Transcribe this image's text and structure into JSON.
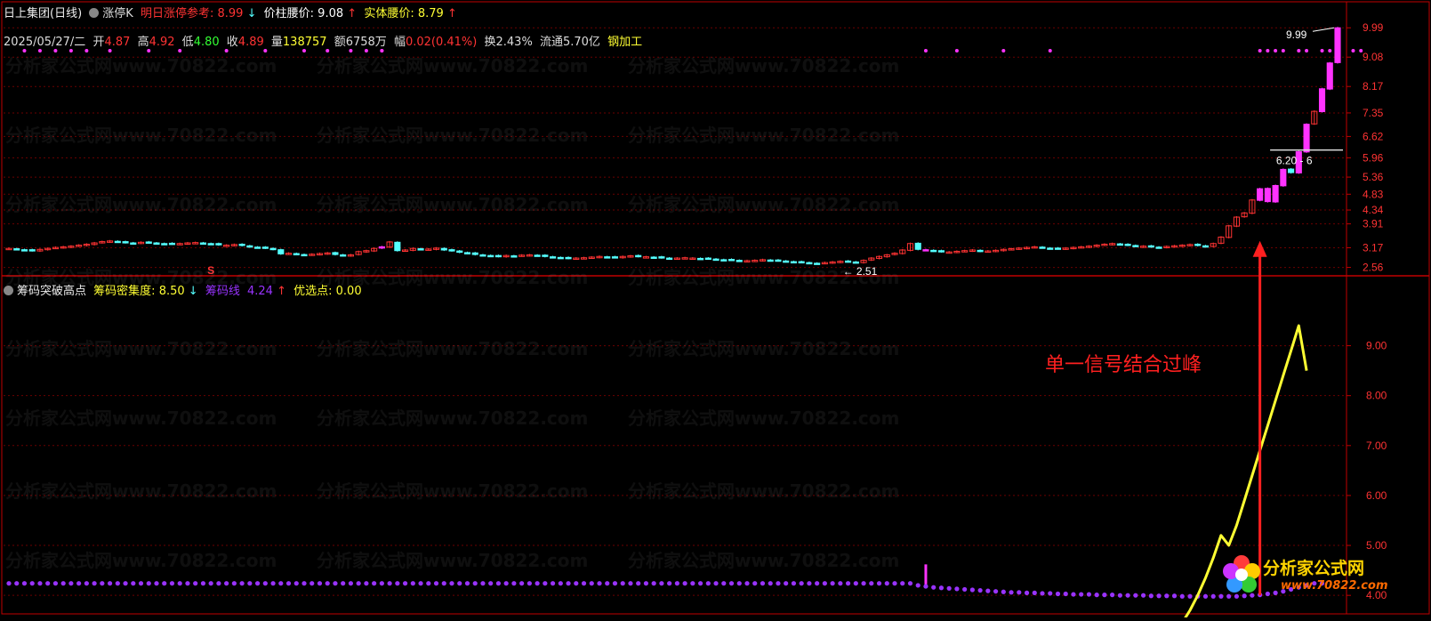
{
  "colors": {
    "up": "#ff3333",
    "down": "#54ffff",
    "limit_up": "#ff33ff",
    "border": "#c00000",
    "grid": "#6b0000",
    "yellow": "#ffff33",
    "purple": "#9933ff",
    "white": "#ffffff"
  },
  "header": {
    "stock_name": "日上集团(日线)",
    "indicator": "涨停K",
    "next_limit_label": "明日涨停参考:",
    "next_limit_value": "8.99",
    "next_limit_arrow": "↓",
    "bar_waist_label": "价柱腰价:",
    "bar_waist_value": "9.08",
    "bar_waist_arrow": "↑",
    "body_waist_label": "实体腰价:",
    "body_waist_value": "8.79",
    "body_waist_arrow": "↑"
  },
  "quote": {
    "date": "2025/05/27/二",
    "open_label": "开",
    "open": "4.87",
    "high_label": "高",
    "high": "4.92",
    "low_label": "低",
    "low": "4.80",
    "close_label": "收",
    "close": "4.89",
    "volume_label": "量",
    "volume": "138757",
    "amount_label": "额",
    "amount": "6758万",
    "change_label": "幅",
    "change": "0.02(0.41%)",
    "turnover_label": "换",
    "turnover": "2.43%",
    "float_label": "流通",
    "float_value": "5.70亿",
    "industry": "钢加工"
  },
  "lower_header": {
    "title": "筹码突破高点",
    "density_label": "筹码密集度:",
    "density_value": "8.50",
    "density_arrow": "↓",
    "chip_line_label": "筹码线",
    "chip_line_value": "4.24",
    "chip_line_arrow": "↑",
    "pick_label": "优选点:",
    "pick_value": "0.00"
  },
  "annotations": {
    "signal_text": "单一信号结合过峰",
    "max_label": "9.99",
    "low_label": "2.51",
    "range_label": "6.20 - 6",
    "s_marker": "S"
  },
  "watermark": {
    "text": "分析家公式网www.70822.com"
  },
  "logo": {
    "name": "分析家公式网",
    "url": "www.70822.com"
  },
  "chart_data": [
    {
      "type": "candlestick",
      "ylim": [
        2.3,
        10.3
      ],
      "y_ticks": [
        "9.99",
        "9.08",
        "8.17",
        "7.35",
        "6.62",
        "5.96",
        "5.36",
        "4.83",
        "4.34",
        "3.91",
        "3.17",
        "2.56"
      ],
      "y_tick_values": [
        9.99,
        9.08,
        8.17,
        7.35,
        6.62,
        5.96,
        5.36,
        4.83,
        4.34,
        3.91,
        3.17,
        2.56
      ],
      "closes": [
        3.15,
        3.12,
        3.1,
        3.08,
        3.12,
        3.15,
        3.18,
        3.2,
        3.22,
        3.25,
        3.28,
        3.32,
        3.36,
        3.38,
        3.35,
        3.33,
        3.32,
        3.34,
        3.33,
        3.31,
        3.3,
        3.29,
        3.3,
        3.32,
        3.33,
        3.31,
        3.29,
        3.26,
        3.25,
        3.27,
        3.24,
        3.2,
        3.18,
        3.16,
        3.12,
        2.98,
        3.0,
        2.97,
        2.95,
        2.97,
        2.99,
        3.01,
        2.96,
        2.93,
        2.95,
        3.05,
        3.08,
        3.15,
        3.2,
        3.35,
        3.08,
        3.1,
        3.15,
        3.12,
        3.13,
        3.16,
        3.1,
        3.08,
        3.03,
        3.0,
        2.96,
        2.94,
        2.92,
        2.9,
        2.93,
        2.92,
        2.94,
        2.95,
        2.93,
        2.9,
        2.88,
        2.86,
        2.84,
        2.85,
        2.86,
        2.88,
        2.9,
        2.88,
        2.87,
        2.9,
        2.92,
        2.9,
        2.89,
        2.88,
        2.86,
        2.84,
        2.85,
        2.86,
        2.85,
        2.84,
        2.83,
        2.81,
        2.8,
        2.79,
        2.78,
        2.77,
        2.78,
        2.8,
        2.78,
        2.77,
        2.75,
        2.73,
        2.72,
        2.7,
        2.69,
        2.71,
        2.73,
        2.75,
        2.74,
        2.72,
        2.78,
        2.85,
        2.9,
        2.95,
        3.0,
        3.1,
        3.3,
        3.12,
        3.1,
        3.07,
        3.05,
        3.04,
        3.06,
        3.08,
        3.1,
        3.06,
        3.07,
        3.09,
        3.12,
        3.14,
        3.16,
        3.18,
        3.2,
        3.17,
        3.15,
        3.14,
        3.16,
        3.18,
        3.2,
        3.22,
        3.25,
        3.28,
        3.3,
        3.27,
        3.25,
        3.23,
        3.22,
        3.2,
        3.19,
        3.21,
        3.23,
        3.25,
        3.27,
        3.24,
        3.22,
        3.3,
        3.5,
        3.85,
        4.12,
        4.25,
        4.65,
        5.0,
        4.6,
        5.1,
        5.6,
        5.5,
        6.15,
        7.0,
        7.4,
        8.1,
        8.9,
        9.99
      ],
      "limit_up_days": [
        48,
        118,
        161,
        162,
        163,
        164,
        166,
        167,
        169,
        170,
        171,
        173,
        174
      ],
      "signal_day": 161
    },
    {
      "type": "line",
      "ylim": [
        3.7,
        10.4
      ],
      "y_ticks": [
        "9.00",
        "8.00",
        "7.00",
        "6.00",
        "5.00",
        "4.00"
      ],
      "y_tick_values": [
        9.0,
        8.0,
        7.0,
        6.0,
        5.0,
        4.0
      ],
      "series": [
        {
          "name": "筹码线",
          "values": [
            4.24,
            4.24,
            4.24,
            4.24,
            4.24,
            4.24,
            4.24,
            4.24,
            4.24,
            4.24,
            4.24,
            4.24,
            4.24,
            4.24,
            4.24,
            4.24,
            4.24,
            4.24,
            4.24,
            4.24,
            4.24,
            4.24,
            4.24,
            4.24,
            4.24,
            4.24,
            4.24,
            4.24,
            4.24,
            4.24,
            4.24,
            4.24,
            4.24,
            4.24,
            4.24,
            4.24,
            4.24,
            4.24,
            4.24,
            4.24,
            4.24,
            4.24,
            4.24,
            4.24,
            4.24,
            4.24,
            4.24,
            4.24,
            4.24,
            4.24,
            4.24,
            4.24,
            4.24,
            4.24,
            4.24,
            4.24,
            4.24,
            4.24,
            4.24,
            4.24,
            4.24,
            4.24,
            4.24,
            4.24,
            4.24,
            4.24,
            4.24,
            4.24,
            4.24,
            4.24,
            4.24,
            4.24,
            4.24,
            4.24,
            4.24,
            4.24,
            4.24,
            4.24,
            4.24,
            4.24,
            4.24,
            4.24,
            4.24,
            4.24,
            4.24,
            4.24,
            4.24,
            4.24,
            4.24,
            4.24,
            4.24,
            4.24,
            4.24,
            4.24,
            4.24,
            4.24,
            4.24,
            4.24,
            4.24,
            4.24,
            4.24,
            4.24,
            4.24,
            4.24,
            4.24,
            4.24,
            4.24,
            4.24,
            4.24,
            4.24,
            4.24,
            4.24,
            4.24,
            4.24,
            4.24,
            4.24,
            4.24,
            4.2,
            4.18,
            4.16,
            4.15,
            4.14,
            4.13,
            4.12,
            4.11,
            4.1,
            4.09,
            4.08,
            4.07,
            4.06,
            4.06,
            4.05,
            4.05,
            4.04,
            4.04,
            4.03,
            4.03,
            4.02,
            4.02,
            4.02,
            4.01,
            4.01,
            4.01,
            4.0,
            4.0,
            4.0,
            4.0,
            3.99,
            3.99,
            3.99,
            3.99,
            3.98,
            3.98,
            3.98,
            3.98,
            3.98,
            3.98,
            3.98,
            3.98,
            3.99,
            4.0,
            4.01,
            4.03,
            4.05,
            4.08,
            4.12,
            4.16,
            4.2,
            4.24,
            4.24
          ]
        },
        {
          "name": "筹码密集度",
          "values": [
            3.3,
            3.28,
            3.27,
            3.28,
            3.3,
            3.35,
            3.38,
            3.4,
            3.42,
            3.44,
            3.45,
            3.43,
            3.41,
            3.4,
            3.42,
            3.41,
            3.39,
            3.38,
            3.4,
            3.41,
            3.42,
            3.41,
            3.4,
            3.38,
            3.36,
            3.35,
            3.34,
            3.33,
            3.34,
            3.33,
            3.3,
            3.22,
            3.15,
            3.08,
            3.05,
            3.07,
            3.1,
            3.08,
            3.06,
            3.07,
            3.1,
            3.12,
            3.2,
            3.35,
            3.44,
            3.3,
            3.22,
            3.2,
            3.24,
            3.25,
            3.2,
            3.15,
            3.12,
            3.1,
            3.08,
            3.06,
            3.08,
            3.1,
            3.05,
            3.02,
            3.0,
            2.99,
            3.0,
            3.02,
            3.04,
            3.06,
            3.05,
            3.04,
            3.03,
            3.01,
            3.0,
            3.02,
            3.04,
            3.06,
            3.05,
            3.03,
            3.02,
            3.01,
            3.02,
            3.04,
            3.03,
            3.02,
            3.01,
            3.0,
            2.99,
            2.98,
            3.0,
            3.02,
            3.01,
            3.0,
            2.99,
            2.98,
            2.97,
            2.96,
            2.98,
            2.99,
            2.98,
            2.97,
            2.96,
            2.95,
            2.94,
            2.95,
            2.96,
            2.98,
            3.0,
            3.05,
            3.12,
            3.18,
            3.25,
            3.3,
            3.15,
            3.1,
            3.12,
            3.14,
            3.13,
            3.12,
            3.11,
            3.12,
            3.13,
            3.14,
            3.15,
            3.13,
            3.12,
            3.14,
            3.16,
            3.18,
            3.15,
            3.14,
            3.16,
            3.18,
            3.2,
            3.22,
            3.25,
            3.27,
            3.28,
            3.3,
            3.28,
            3.26,
            3.25,
            3.27,
            3.3,
            3.32,
            3.3,
            3.28,
            3.26,
            3.25,
            3.27,
            3.3,
            3.32,
            3.34,
            3.35,
            3.45,
            3.7,
            4.0,
            4.35,
            4.75,
            5.2,
            5.0,
            5.4,
            5.9,
            6.4,
            6.9,
            7.4,
            7.9,
            8.4,
            8.9,
            9.4,
            8.5
          ]
        }
      ]
    }
  ]
}
